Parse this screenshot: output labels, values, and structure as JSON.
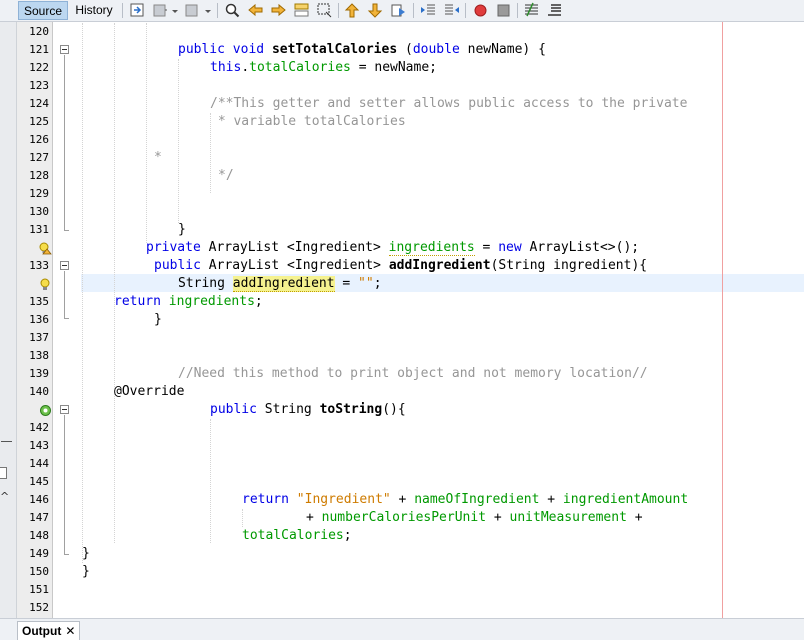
{
  "toolbar": {
    "source_tab": "Source",
    "history_tab": "History",
    "icons": [
      "last-edit-icon",
      "back-icon",
      "forward-icon",
      "find-icon",
      "find-previous-icon",
      "find-next-icon",
      "toggle-highlight-icon",
      "toggle-rectangular-selection-icon",
      "previous-bookmark-icon",
      "next-bookmark-icon",
      "toggle-bookmark-icon",
      "shift-left-icon",
      "shift-right-icon",
      "start-macro-icon",
      "stop-macro-icon",
      "comment-icon",
      "uncomment-icon"
    ]
  },
  "colors": {
    "keyword": "#0000e6",
    "field": "#009900",
    "comment": "#969696",
    "string": "#ce7b00",
    "current_line": "#e8f2fe",
    "margin_line": "#f0a0a0"
  },
  "line_numbers": [
    "120",
    "121",
    "122",
    "123",
    "124",
    "125",
    "126",
    "127",
    "128",
    "129",
    "130",
    "131",
    "132",
    "133",
    "134",
    "135",
    "136",
    "137",
    "138",
    "139",
    "140",
    "141",
    "142",
    "143",
    "144",
    "145",
    "146",
    "147",
    "148",
    "149",
    "150",
    "151",
    "152"
  ],
  "code": {
    "l121": {
      "kw1": "public",
      "kw2": "void",
      "name": "setTotalCalories",
      "open": " (",
      "kw3": "double",
      "rest": " newName) {"
    },
    "l122": {
      "kw": "this",
      "dot": ".",
      "field": "totalCalories",
      "rest": " = newName;"
    },
    "l124": "/**This getter and setter allows public access to the private",
    "l125": " * variable totalCalories",
    "l127": "*",
    "l128": "*/",
    "l131": "}",
    "l132": {
      "kw1": "private",
      "type": " ArrayList <Ingredient> ",
      "field": "ingredients",
      "eq": " = ",
      "kw2": "new",
      "rest": " ArrayList<>();"
    },
    "l133": {
      "kw1": "public",
      "type": " ArrayList <Ingredient> ",
      "name": "addIngredient",
      "rest": "(String ingredient){"
    },
    "l134": {
      "type": "String ",
      "name": "addIngredient",
      "eq": " = ",
      "str": "\"\"",
      "end": ";"
    },
    "l135": {
      "kw": "return",
      "sp": " ",
      "field": "ingredients",
      "end": ";"
    },
    "l136": "}",
    "l139": "//Need this method to print object and not memory location//",
    "l140": "@Override",
    "l141": {
      "kw": "public",
      "type": " String ",
      "name": "toString",
      "rest": "(){"
    },
    "l146": {
      "kw": "return",
      "sp": " ",
      "str": "\"Ingredient\"",
      "plus1": " + ",
      "f1": "nameOfIngredient",
      "plus2": " + ",
      "f2": "ingredientAmount"
    },
    "l147": {
      "plus1": "+ ",
      "f1": "numberCaloriesPerUnit",
      "plus2": " + ",
      "f2": "unitMeasurement",
      "plus3": " +"
    },
    "l148": {
      "f1": "totalCalories",
      "end": ";"
    },
    "l149": "}",
    "l150": "}"
  },
  "output": {
    "tab_label": "Output",
    "close": "✕"
  }
}
